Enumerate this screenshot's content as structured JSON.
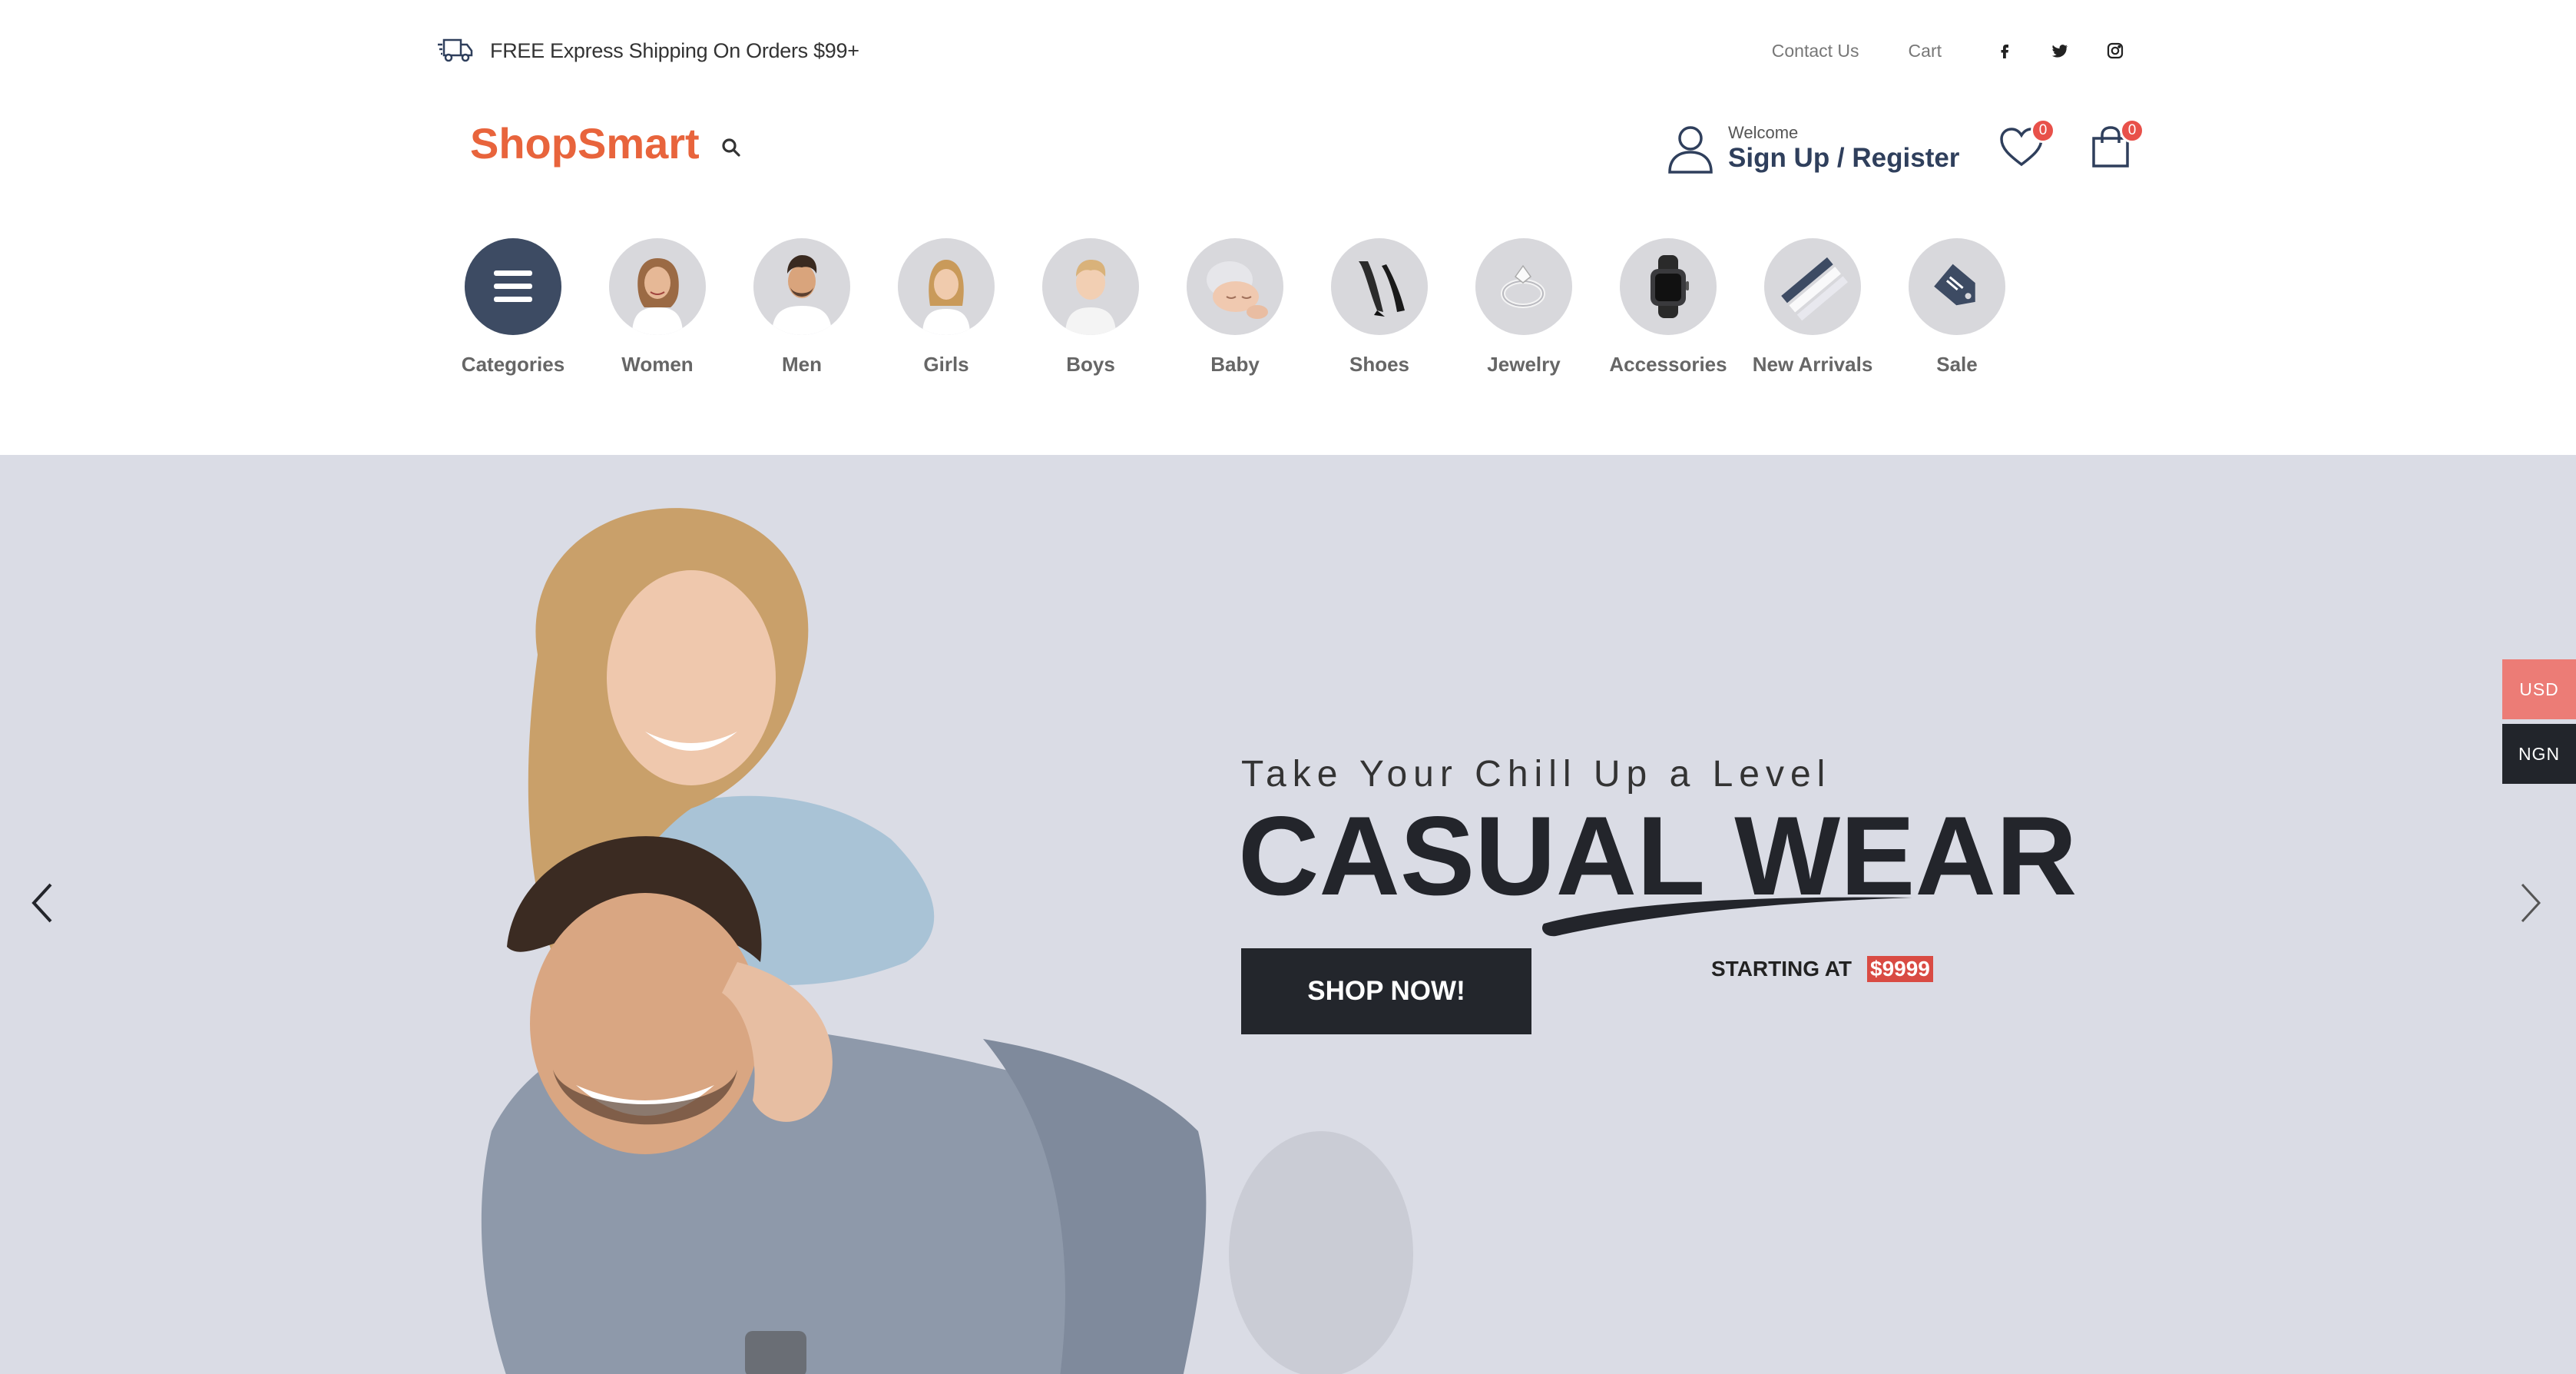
{
  "topbar": {
    "shipping_text": "FREE Express Shipping On Orders $99+",
    "links": [
      "Contact Us",
      "Cart"
    ],
    "social": [
      "facebook-icon",
      "twitter-icon",
      "instagram-icon"
    ]
  },
  "header": {
    "logo": "ShopSmart",
    "welcome": "Welcome",
    "signup": "Sign Up / Register",
    "wishlist_count": "0",
    "cart_count": "0"
  },
  "categories": [
    {
      "label": "Categories",
      "icon": "menu-icon"
    },
    {
      "label": "Women",
      "icon": "women-photo"
    },
    {
      "label": "Men",
      "icon": "men-photo"
    },
    {
      "label": "Girls",
      "icon": "girls-photo"
    },
    {
      "label": "Boys",
      "icon": "boys-photo"
    },
    {
      "label": "Baby",
      "icon": "baby-photo"
    },
    {
      "label": "Shoes",
      "icon": "shoe-photo"
    },
    {
      "label": "Jewelry",
      "icon": "ring-photo"
    },
    {
      "label": "Accessories",
      "icon": "watch-photo"
    },
    {
      "label": "New Arrivals",
      "icon": "new-arrivals-photo"
    },
    {
      "label": "Sale",
      "icon": "sale-tag-icon"
    }
  ],
  "hero": {
    "subtitle": "Take Your Chill Up a Level",
    "title": "CASUAL WEAR",
    "button": "SHOP NOW!",
    "starting_label": "STARTING AT",
    "price": "$9999"
  },
  "currency": {
    "usd": "USD",
    "ngn": "NGN"
  },
  "colors": {
    "brand": "#e8643c",
    "navy": "#2f3f5c",
    "badge": "#e8514a",
    "hero_bg": "#dadce5",
    "button_dark": "#23262c",
    "usd_bg": "#ec7c76"
  }
}
